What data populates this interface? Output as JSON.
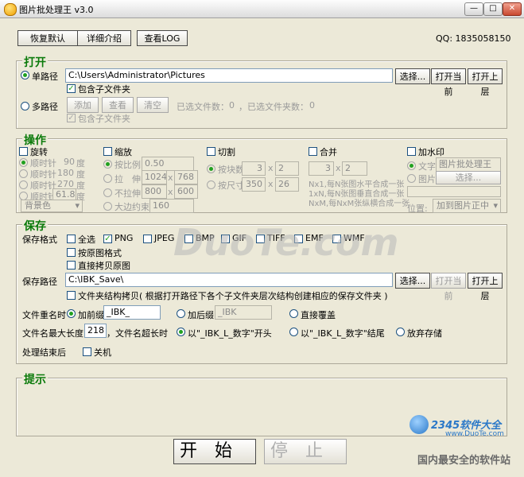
{
  "window": {
    "title": "图片批处理王 v3.0",
    "min": "—",
    "max": "□",
    "close": "✕"
  },
  "toolbar": {
    "restore": "恢复默认",
    "intro": "详细介绍",
    "log": "查看LOG",
    "qq": "QQ: 1835058150"
  },
  "open": {
    "title": "打开",
    "single": "单路径",
    "path": "C:\\Users\\Administrator\\Pictures",
    "choose": "选择...",
    "open_current": "打开当前",
    "open_parent": "打开上层",
    "include_sub": "包含子文件夹",
    "multi": "多路径",
    "add": "添加",
    "view": "查看",
    "clear": "清空",
    "chosen_files": "已选文件数：",
    "chosen_files_count": "0",
    "chosen_dirs": "，已选文件夹数：",
    "chosen_dirs_count": "0",
    "include_sub2": "包含子文件夹"
  },
  "ops": {
    "title": "操作",
    "rotate": "旋转",
    "rot": [
      {
        "label": "顺时针",
        "value": "90",
        "unit": "度"
      },
      {
        "label": "顺时针",
        "value": "180",
        "unit": "度"
      },
      {
        "label": "顺时针",
        "value": "270",
        "unit": "度"
      },
      {
        "label": "顺时针",
        "value": "61.8",
        "unit": "度"
      }
    ],
    "bg": "背景色",
    "scale": "缩放",
    "by_ratio": "按比例",
    "ratio_val": "0.50",
    "stretch": "拉　伸",
    "stretch_w": "1024",
    "stretch_h": "768",
    "no_stretch": "不拉伸",
    "nostretch_w": "800",
    "nostretch_h": "600",
    "maxside": "大边约束",
    "maxside_val": "160",
    "x": "x",
    "cut": "切割",
    "by_blocks": "按块数",
    "blocks_a": "3",
    "blocks_b": "2",
    "by_size": "按尺寸",
    "size_a": "350",
    "size_b": "26",
    "merge": "合并",
    "merge_a": "3",
    "merge_b": "2",
    "merge_desc1": "Nx1,每N张图水平合成一张",
    "merge_desc2": "1xN,每N张图垂直合成一张",
    "merge_desc3": "NxM,每NxM张纵横合成一张",
    "watermark": "加水印",
    "wm_text": "文字",
    "wm_text_val": "图片批处理王",
    "wm_image": "图片",
    "wm_choose": "选择...",
    "position": "位置:",
    "position_val": "加到图片正中"
  },
  "save": {
    "title": "保存",
    "format_label": "保存格式",
    "all": "全选",
    "formats": [
      "PNG",
      "JPEG",
      "BMP",
      "GIF",
      "TIFF",
      "EMF",
      "WMF"
    ],
    "keep_format": "按原图格式",
    "copy_orig": "直接拷贝原图",
    "path_label": "保存路径",
    "path": "C:\\IBK_Save\\",
    "choose": "选择...",
    "open_current": "打开当前",
    "open_parent": "打开上层",
    "struct_copy": "文件夹结构拷贝( 根据打开路径下各个子文件夹层次结构创建相应的保存文件夹 )",
    "rename_label": "文件重名时",
    "prefix": "加前缀",
    "prefix_val": "_IBK_",
    "suffix": "加后缀",
    "suffix_val": "_IBK",
    "overwrite": "直接覆盖",
    "maxlen_label": "文件名最大长度",
    "maxlen_val": "218",
    "toolong": "，文件名超长时",
    "opt_head": "以\"_IBK_L_数字\"开头",
    "opt_tail": "以\"_IBK_L_数字\"结尾",
    "opt_skip": "放弃存储",
    "after_label": "处理结束后",
    "shutdown": "关机"
  },
  "hint": {
    "title": "提示"
  },
  "actions": {
    "start": "开始",
    "stop": "停止"
  },
  "watermark_brand": {
    "site": "DuoTe.com",
    "logo": "2345软件大全",
    "url": "www.DuoTe.com",
    "slogan": "国内最安全的软件站"
  }
}
